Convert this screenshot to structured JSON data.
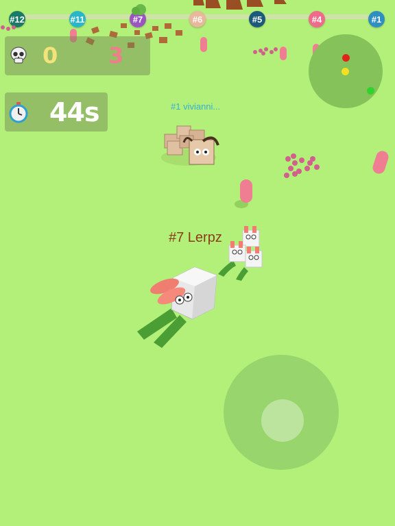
{
  "ranks": [
    {
      "label": "#12",
      "color": "#1a7a66"
    },
    {
      "label": "#11",
      "color": "#2ab6c9"
    },
    {
      "label": "#7",
      "color": "#9b55c0"
    },
    {
      "label": "#6",
      "color": "#e9b79a"
    },
    {
      "label": "#5",
      "color": "#1b5a78"
    },
    {
      "label": "#4",
      "color": "#f06b8a"
    },
    {
      "label": "#1",
      "color": "#2f8fc0"
    }
  ],
  "hud": {
    "kills_icon": "skull-icon",
    "kills_you": "0",
    "kills_best": "3",
    "timer_icon": "stopwatch-icon",
    "time_left": "44s"
  },
  "players": {
    "enemy_name": "#1 vivianni...",
    "player_name": "#7 Lerpz"
  },
  "minimap": {
    "dots": [
      {
        "color": "#e0241c"
      },
      {
        "color": "#f3e020"
      },
      {
        "color": "#2fd32c"
      }
    ]
  },
  "colors": {
    "ground": "#b3f07a",
    "pill": "#f07e92"
  }
}
